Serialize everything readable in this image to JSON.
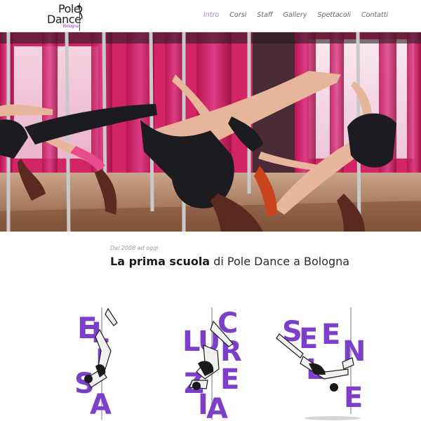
{
  "logo": {
    "line1": "Pole",
    "line2": "Dance",
    "line3": "Bologna"
  },
  "nav": {
    "items": [
      {
        "label": "Intro",
        "active": true
      },
      {
        "label": "Corsi",
        "active": false
      },
      {
        "label": "Staff",
        "active": false
      },
      {
        "label": "Gallery",
        "active": false
      },
      {
        "label": "Spettacoli",
        "active": false
      },
      {
        "label": "Contatti",
        "active": false
      }
    ]
  },
  "intro": {
    "since": "Dai 2008 ad oggi",
    "title_bold": "La prima scuola",
    "title_rest": " di Pole Dance a Bologna"
  },
  "instructors": [
    {
      "name_letters": [
        "E",
        "L",
        "I",
        "S",
        "A"
      ]
    },
    {
      "name_letters": [
        "L",
        "U",
        "C",
        "R",
        "E",
        "Z",
        "I",
        "A"
      ]
    },
    {
      "name_letters": [
        "S",
        "E",
        "L",
        "E",
        "N",
        "E"
      ]
    }
  ],
  "colors": {
    "accent": "#7d3fc9",
    "nav_active": "#a883d6",
    "curtain": "#c8195f"
  }
}
